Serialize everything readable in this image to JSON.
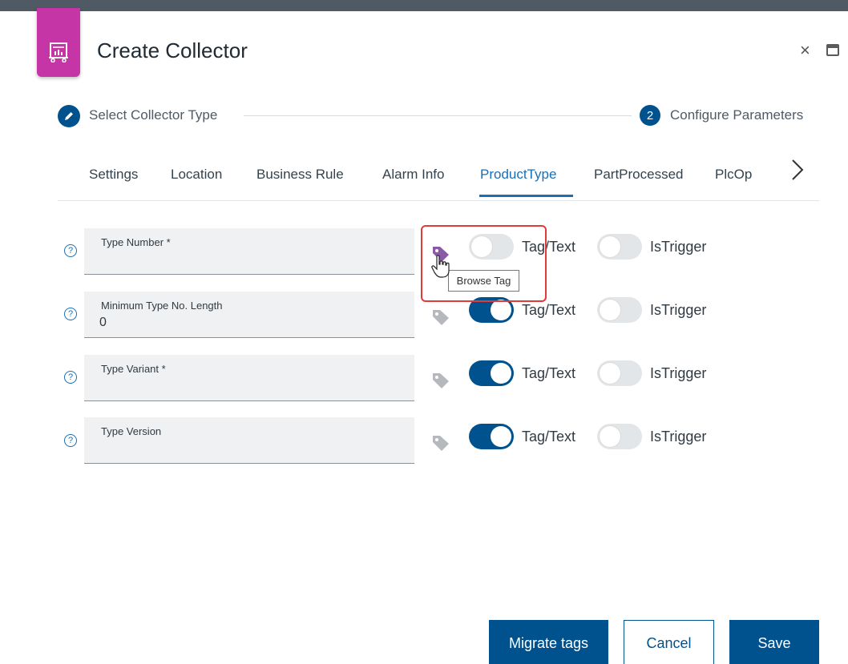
{
  "dialog": {
    "title": "Create Collector",
    "icon": "collector-chart-icon",
    "accent": "#c535a5"
  },
  "stepper": {
    "step1": {
      "label": "Select Collector Type",
      "icon": "pencil-icon"
    },
    "step2": {
      "number": "2",
      "label": "Configure Parameters"
    }
  },
  "tabs": [
    "Settings",
    "Location",
    "Business Rule",
    "Alarm Info",
    "ProductType",
    "PartProcessed",
    "PlcOp"
  ],
  "active_tab": "ProductType",
  "fields": [
    {
      "label": "Type Number *",
      "value": "",
      "tag_text_on": false,
      "is_trigger_on": false,
      "tag_active": true
    },
    {
      "label": "Minimum Type No. Length",
      "value": "0",
      "tag_text_on": true,
      "is_trigger_on": false,
      "tag_active": false
    },
    {
      "label": "Type Variant *",
      "value": "",
      "tag_text_on": true,
      "is_trigger_on": false,
      "tag_active": false
    },
    {
      "label": "Type Version",
      "value": "",
      "tag_text_on": true,
      "is_trigger_on": false,
      "tag_active": false
    }
  ],
  "toggle_labels": {
    "tag_text": "Tag/Text",
    "is_trigger": "IsTrigger"
  },
  "help_glyph": "?",
  "tooltip": "Browse Tag",
  "buttons": {
    "migrate": "Migrate tags",
    "cancel": "Cancel",
    "save": "Save"
  },
  "window_controls": {
    "close": "×"
  },
  "colors": {
    "primary": "#00528f",
    "tab_active": "#1b6fb3",
    "highlight": "#e03a3a",
    "tag_active": "#8a5aa8",
    "tag_inactive": "#b5b9bd"
  }
}
